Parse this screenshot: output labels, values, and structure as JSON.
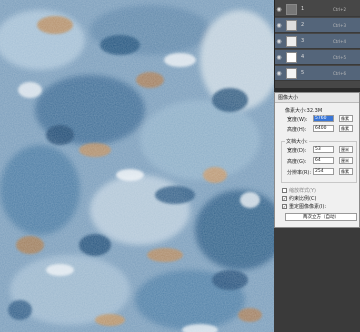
{
  "channels": {
    "rows": [
      {
        "name": "1",
        "shortcut": "Ctrl+2",
        "selected": false
      },
      {
        "name": "2",
        "shortcut": "Ctrl+3",
        "selected": true
      },
      {
        "name": "3",
        "shortcut": "Ctrl+4",
        "selected": true
      },
      {
        "name": "4",
        "shortcut": "Ctrl+5",
        "selected": true
      },
      {
        "name": "5",
        "shortcut": "Ctrl+6",
        "selected": true
      }
    ]
  },
  "image_size_dialog": {
    "title": "图像大小",
    "pixel_dimensions_label": "像素大小:32.3M",
    "width_label": "宽度(W):",
    "width_value": "5760",
    "width_unit": "像素",
    "height_label": "高度(H):",
    "height_value": "6400",
    "height_unit": "像素",
    "document_size_label": "文档大小:",
    "doc_width_label": "宽度(D):",
    "doc_width_value": "53",
    "doc_width_unit": "厘米",
    "doc_height_label": "高度(G):",
    "doc_height_value": "64",
    "doc_height_unit": "厘米",
    "resolution_label": "分辨率(R):",
    "resolution_value": "254",
    "resolution_unit": "像素",
    "scale_styles_label": "缩放样式(Y)",
    "constrain_label": "约束比例(C)",
    "resample_label": "重定图像像素(I):",
    "resample_method": "两次立方（自动）"
  },
  "colors": {
    "canvas_base": "#7a9dbb",
    "panel_bg": "#474747",
    "selected_row": "#54657a",
    "dialog_bg": "#f0f0f0",
    "highlight": "#3875d7"
  }
}
